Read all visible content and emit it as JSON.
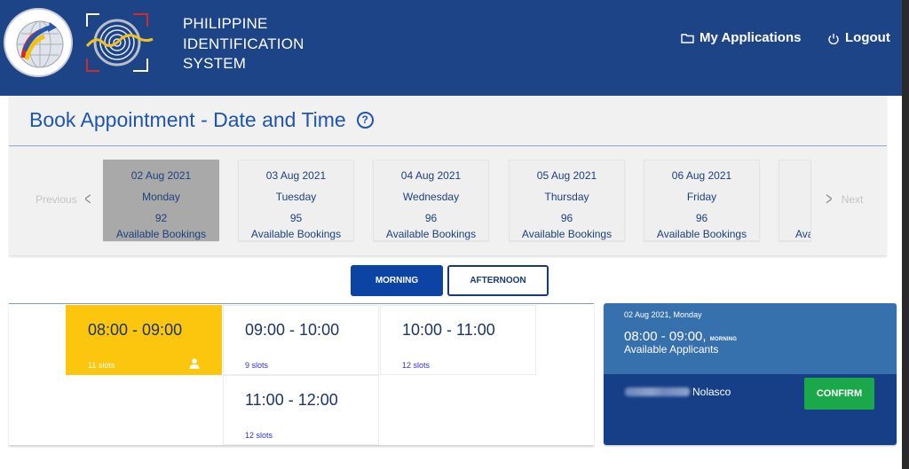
{
  "header": {
    "brand_lines": [
      "PHILIPPINE",
      "IDENTIFICATION",
      "SYSTEM"
    ],
    "nav": [
      {
        "label": "My Applications",
        "icon": "folder-icon"
      },
      {
        "label": "Logout",
        "icon": "power-icon"
      }
    ],
    "logos": [
      "philippine-statistics-authority-logo",
      "philsys-logo"
    ]
  },
  "booking": {
    "title": "Book Appointment - Date and Time",
    "help_icon": "?",
    "prev_label": "Previous",
    "next_label": "Next",
    "dates": [
      {
        "date": "02 Aug 2021",
        "weekday": "Monday",
        "available": "92",
        "available_label": "Available Bookings",
        "selected": true
      },
      {
        "date": "03 Aug 2021",
        "weekday": "Tuesday",
        "available": "95",
        "available_label": "Available Bookings",
        "selected": false
      },
      {
        "date": "04 Aug 2021",
        "weekday": "Wednesday",
        "available": "96",
        "available_label": "Available Bookings",
        "selected": false
      },
      {
        "date": "05 Aug 2021",
        "weekday": "Thursday",
        "available": "96",
        "available_label": "Available Bookings",
        "selected": false
      },
      {
        "date": "06 Aug 2021",
        "weekday": "Friday",
        "available": "96",
        "available_label": "Available Bookings",
        "selected": false
      },
      {
        "date": "",
        "weekday": "",
        "available": "",
        "available_label": "Ava",
        "selected": false
      }
    ]
  },
  "sessions": {
    "tabs": [
      {
        "label": "MORNING",
        "active": true
      },
      {
        "label": "AFTERNOON",
        "active": false
      }
    ]
  },
  "slots": [
    {
      "time": "08:00 - 09:00",
      "count": "11 slots",
      "selected": true
    },
    {
      "time": "09:00 - 10:00",
      "count": "9 slots",
      "selected": false
    },
    {
      "time": "10:00 - 11:00",
      "count": "12 slots",
      "selected": false
    },
    {
      "time": "11:00 - 12:00",
      "count": "12 slots",
      "selected": false
    }
  ],
  "summary": {
    "date": "02 Aug 2021, Monday",
    "time": "08:00 - 09:00,",
    "session": "MORNING",
    "label": "Available Applicants",
    "applicant_last_name": "Nolasco",
    "confirm_label": "CONFIRM"
  },
  "colors": {
    "header_bg": "#1d4486",
    "title_blue": "#1e55b4",
    "selected_slot": "#fcc60f",
    "active_tab": "#0b44a3",
    "summary_top": "#3670ad",
    "summary_bottom": "#163f87",
    "confirm_green": "#1ba84a"
  }
}
